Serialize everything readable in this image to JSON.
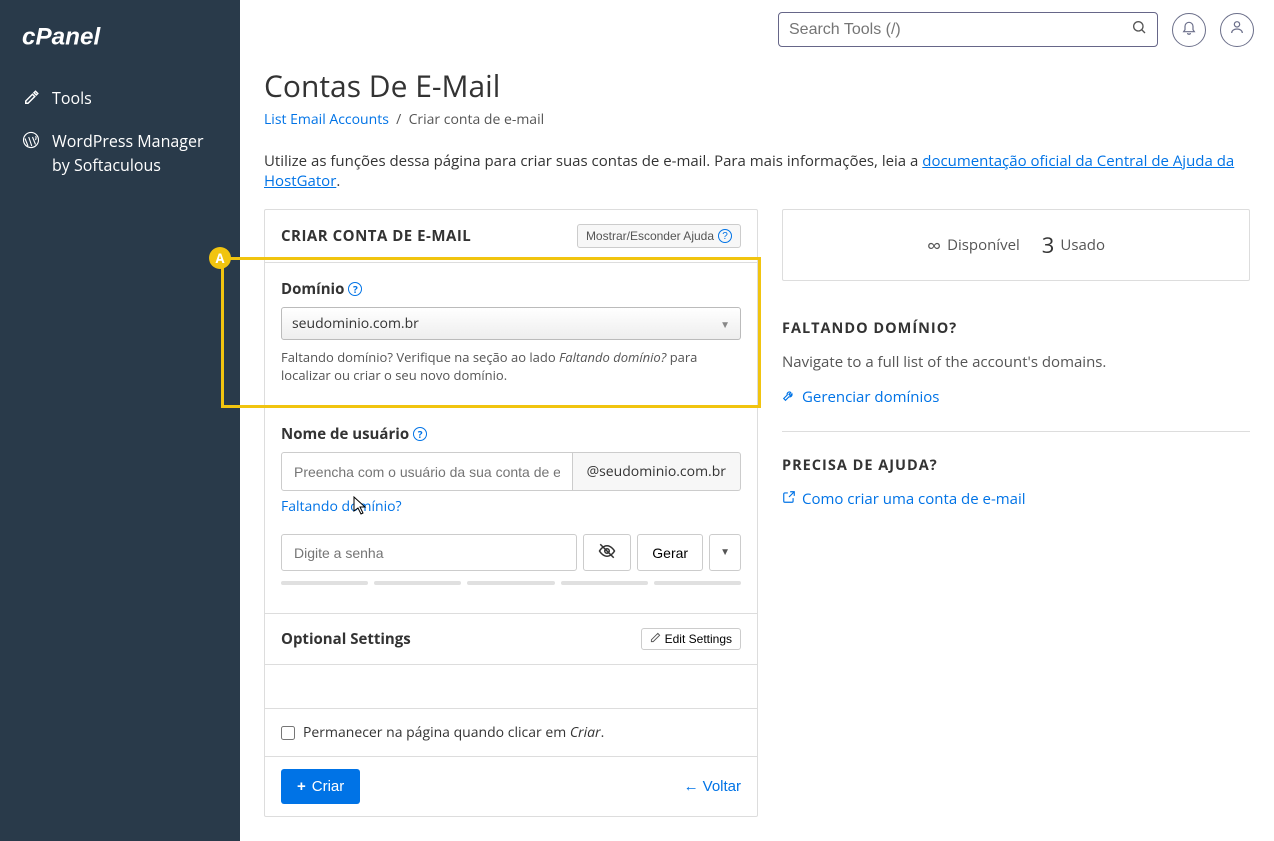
{
  "sidebar": {
    "logo_text": "cPanel",
    "items": [
      {
        "label": "Tools"
      },
      {
        "label": "WordPress Manager by Softaculous"
      }
    ]
  },
  "topbar": {
    "search_placeholder": "Search Tools (/)"
  },
  "page": {
    "title": "Contas De E-Mail",
    "breadcrumb_link": "List Email Accounts",
    "breadcrumb_sep": "/",
    "breadcrumb_current": "Criar conta de e-mail",
    "desc_prefix": "Utilize as funções dessa página para criar suas contas de e-mail. Para mais informações, leia a ",
    "desc_link": "documentação oficial da Central de Ajuda da HostGator",
    "desc_suffix": "."
  },
  "panel": {
    "title": "CRIAR CONTA DE E-MAIL",
    "help_toggle": "Mostrar/Esconder Ajuda",
    "highlight_badge": "A",
    "domain": {
      "label": "Domínio",
      "value": "seudominio.com.br",
      "hint_prefix": "Faltando domínio? Verifique na seção ao lado ",
      "hint_em": "Faltando domínio?",
      "hint_suffix": " para localizar ou criar o seu novo domínio."
    },
    "username": {
      "label": "Nome de usuário",
      "placeholder": "Preencha com o usuário da sua conta de e-mail",
      "suffix": "@seudominio.com.br",
      "missing_link": "Faltando domínio?"
    },
    "password": {
      "placeholder": "Digite a senha",
      "generate": "Gerar"
    },
    "optional": {
      "title": "Optional Settings",
      "edit": "Edit Settings"
    },
    "stay": {
      "text_prefix": "Permanecer na página quando clicar em ",
      "text_em": "Criar",
      "text_suffix": "."
    },
    "actions": {
      "create": "Criar",
      "back": "Voltar"
    }
  },
  "right": {
    "stats": {
      "available_label": "Disponível",
      "used_value": "3",
      "used_label": "Usado"
    },
    "missing": {
      "title": "FALTANDO DOMÍNIO?",
      "text": "Navigate to a full list of the account's domains.",
      "link": "Gerenciar domínios"
    },
    "help": {
      "title": "PRECISA DE AJUDA?",
      "link": "Como criar uma conta de e-mail"
    }
  }
}
